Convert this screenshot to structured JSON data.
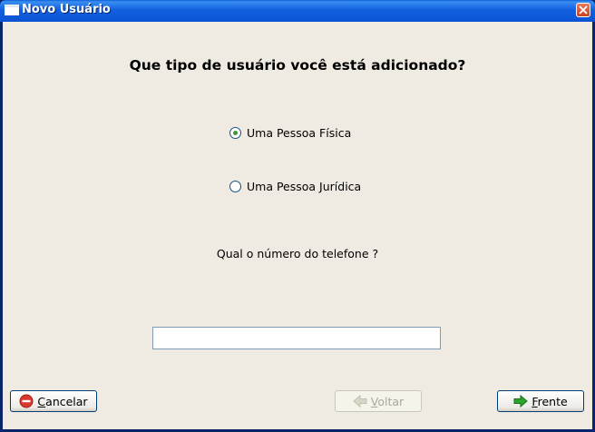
{
  "window": {
    "title": "Novo Usuário"
  },
  "main": {
    "question": "Que tipo de usuário você está adicionado?",
    "options": [
      {
        "label": "Uma Pessoa Física",
        "checked": true
      },
      {
        "label": "Uma Pessoa Jurídica",
        "checked": false
      }
    ],
    "phone_label": "Qual o número do telefone ?",
    "phone_value": ""
  },
  "buttons": {
    "cancel": {
      "mnemonic": "C",
      "rest": "ancelar",
      "icon": "cancel-icon"
    },
    "back": {
      "mnemonic": "V",
      "rest": "oltar",
      "icon": "arrow-left-icon",
      "enabled": false
    },
    "forward": {
      "mnemonic": "F",
      "rest": "rente",
      "icon": "arrow-right-icon"
    }
  },
  "colors": {
    "title_bar": "#1160e0",
    "radio_dot": "#3f9c35",
    "cancel_icon": "#d9382d",
    "forward_arrow": "#2ea62e"
  }
}
